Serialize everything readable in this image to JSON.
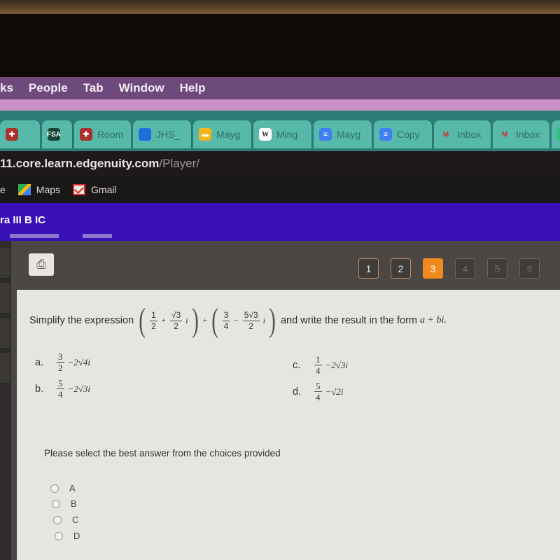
{
  "menubar": {
    "items": [
      "ks",
      "People",
      "Tab",
      "Window",
      "Help"
    ]
  },
  "tabs": [
    {
      "label": "",
      "icon": "school-crest-icon",
      "glyph": "✚"
    },
    {
      "label": "",
      "icon": "fsa-icon",
      "glyph": "FSA"
    },
    {
      "label": "Room",
      "icon": "school-crest-icon",
      "glyph": "✚"
    },
    {
      "label": "JHS_",
      "icon": "classroom-icon",
      "glyph": "👤"
    },
    {
      "label": "Mayg",
      "icon": "slides-icon",
      "glyph": "▬"
    },
    {
      "label": "Ming",
      "icon": "wikipedia-icon",
      "glyph": "W"
    },
    {
      "label": "Mayg",
      "icon": "docs-icon",
      "glyph": "≡"
    },
    {
      "label": "Copy",
      "icon": "docs-icon",
      "glyph": "≡"
    },
    {
      "label": "Inbox",
      "icon": "gmail-icon",
      "glyph": "M"
    },
    {
      "label": "Inbox",
      "icon": "gmail-icon",
      "glyph": "M"
    },
    {
      "label": "",
      "icon": "green-app-icon",
      "glyph": "●"
    }
  ],
  "address": {
    "host": "11.core.learn.edgenuity.com",
    "path": "/Player/"
  },
  "bookmarks": [
    {
      "label": "e",
      "icon": ""
    },
    {
      "label": "Maps",
      "icon": "maps-icon"
    },
    {
      "label": "Gmail",
      "icon": "gmail-icon"
    }
  ],
  "course": {
    "title": "ra III B IC"
  },
  "toolbar": {
    "print_icon": "⎙"
  },
  "pages": [
    {
      "label": "1",
      "state": "visited"
    },
    {
      "label": "2",
      "state": "visited"
    },
    {
      "label": "3",
      "state": "active"
    },
    {
      "label": "4",
      "state": "disabled"
    },
    {
      "label": "5",
      "state": "disabled"
    },
    {
      "label": "6",
      "state": "disabled"
    }
  ],
  "question": {
    "prefix": "Simplify the expression",
    "expr": {
      "t1_num": "1",
      "t1_den": "2",
      "plus1": "+",
      "t2_num": "√3",
      "t2_den": "2",
      "i1": "i",
      "between": "+",
      "t3_num": "3",
      "t3_den": "4",
      "minus": "−",
      "t4_num": "5√3",
      "t4_den": "2",
      "i2": "i"
    },
    "suffix": "and write the result in the form",
    "form": "a + bi."
  },
  "choices": [
    {
      "letter": "a.",
      "num": "3",
      "den": "2",
      "rest": "−2√4i"
    },
    {
      "letter": "b.",
      "num": "5",
      "den": "4",
      "rest": "−2√3i"
    },
    {
      "letter": "c.",
      "num": "1",
      "den": "4",
      "rest": "−2√3i"
    },
    {
      "letter": "d.",
      "num": "5",
      "den": "4",
      "rest": "−√2i"
    }
  ],
  "instructions": "Please select the best answer from the choices provided",
  "options": [
    "A",
    "B",
    "C",
    "D"
  ]
}
